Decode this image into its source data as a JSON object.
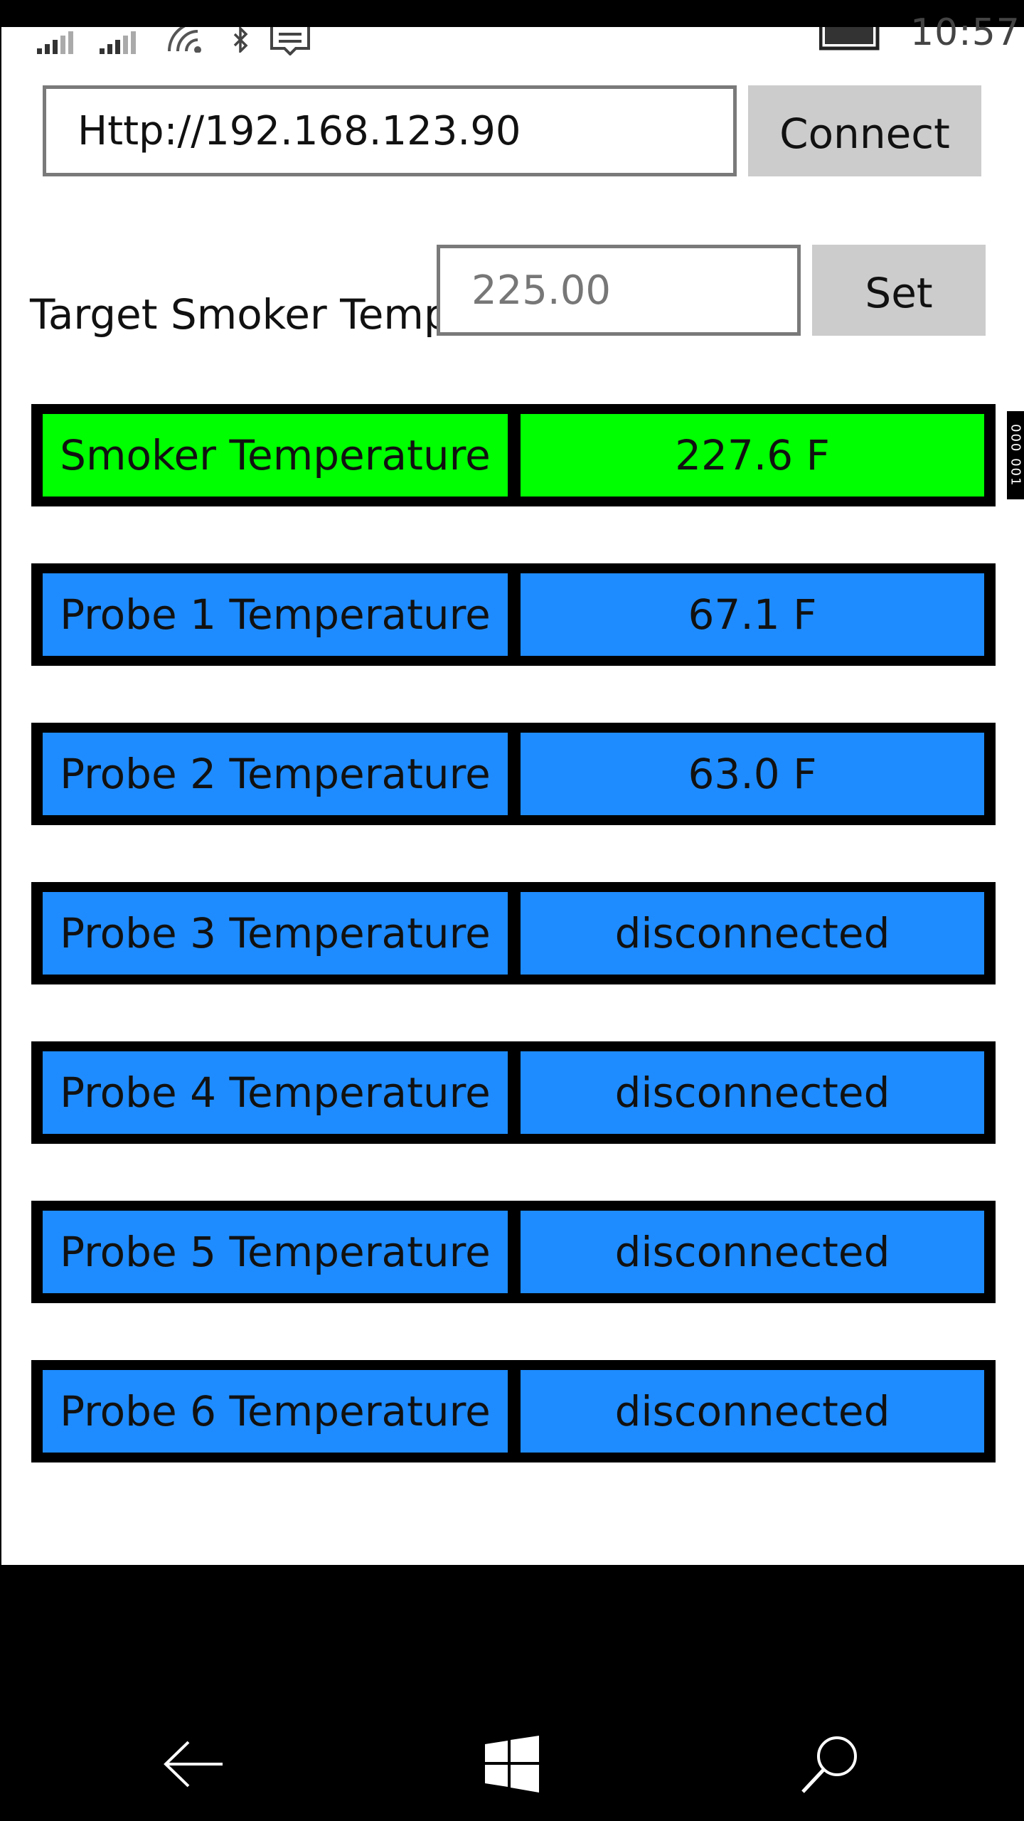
{
  "status_bar": {
    "time": "10:57"
  },
  "connection": {
    "url_value": "Http://192.168.123.90",
    "connect_label": "Connect"
  },
  "target": {
    "label": "Target Smoker Temp:",
    "placeholder": "225.00",
    "set_label": "Set"
  },
  "readings": [
    {
      "label": "Smoker Temperature",
      "value": "227.6 F",
      "color": "#00ff00"
    },
    {
      "label": "Probe 1 Temperature",
      "value": "67.1 F",
      "color": "#1e8cff"
    },
    {
      "label": "Probe 2 Temperature",
      "value": "63.0 F",
      "color": "#1e8cff"
    },
    {
      "label": "Probe 3 Temperature",
      "value": "disconnected",
      "color": "#1e8cff"
    },
    {
      "label": "Probe 4 Temperature",
      "value": "disconnected",
      "color": "#1e8cff"
    },
    {
      "label": "Probe 5 Temperature",
      "value": "disconnected",
      "color": "#1e8cff"
    },
    {
      "label": "Probe 6 Temperature",
      "value": "disconnected",
      "color": "#1e8cff"
    }
  ],
  "side_tab": {
    "text": "000 001"
  },
  "nav_bar": {
    "back_icon": "back-arrow-icon",
    "home_icon": "windows-logo-icon",
    "search_icon": "search-icon"
  }
}
